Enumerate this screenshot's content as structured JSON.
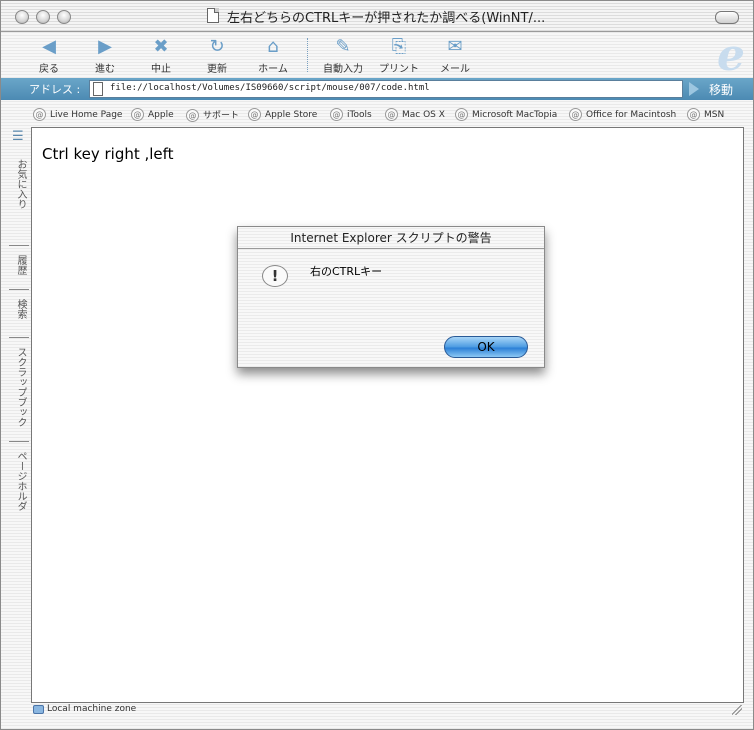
{
  "window": {
    "title": "左右どちらのCTRLキーが押されたか調べる(WinNT/..."
  },
  "toolbar": {
    "back": "戻る",
    "forward": "進む",
    "stop": "中止",
    "refresh": "更新",
    "home": "ホーム",
    "autofill": "自動入力",
    "print": "プリント",
    "mail": "メール"
  },
  "address": {
    "label": "アドレス :",
    "url": "file://localhost/Volumes/IS09660/script/mouse/007/code.html",
    "go": "移動"
  },
  "favorites": [
    "Live Home Page",
    "Apple",
    "サポート",
    "Apple Store",
    "iTools",
    "Mac OS X",
    "Microsoft MacTopia",
    "Office for Macintosh",
    "MSN"
  ],
  "sidebar_tabs": [
    "お気に入り",
    "履歴",
    "検索",
    "スクラップブック",
    "ページホルダ"
  ],
  "page": {
    "text": "Ctrl key right ,left"
  },
  "dialog": {
    "title": "Internet Explorer スクリプトの警告",
    "message": "右のCTRLキー",
    "ok": "OK"
  },
  "status": {
    "zone": "Local machine zone"
  }
}
